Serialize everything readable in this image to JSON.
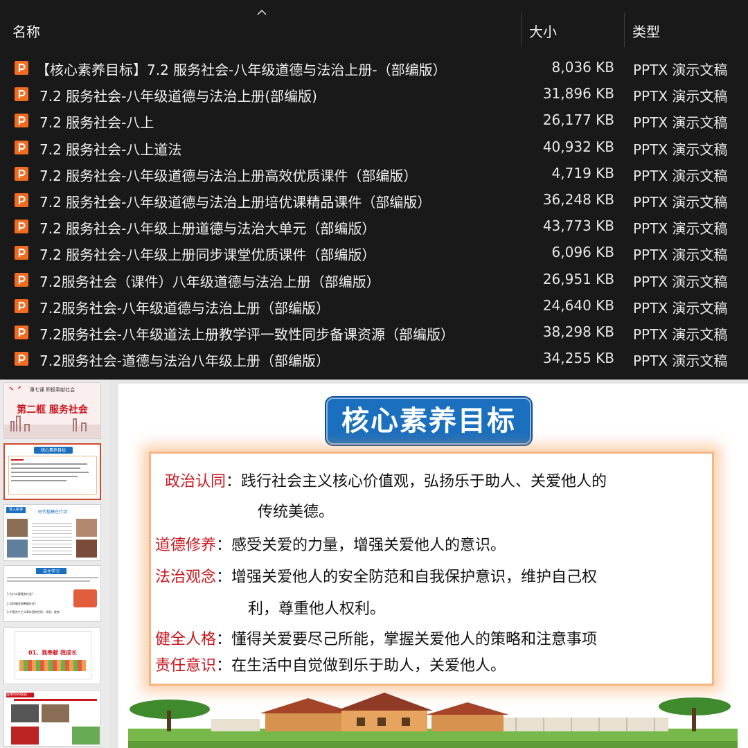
{
  "explorer": {
    "columns": {
      "name": "名称",
      "size": "大小",
      "type": "类型"
    },
    "files": [
      {
        "name": "【核心素养目标】7.2 服务社会-八年级道德与法治上册-（部编版）",
        "size": "8,036 KB",
        "type": "PPTX 演示文稿"
      },
      {
        "name": "7.2  服务社会-八年级道德与法治上册(部编版)",
        "size": "31,896 KB",
        "type": "PPTX 演示文稿"
      },
      {
        "name": "7.2  服务社会-八上",
        "size": "26,177 KB",
        "type": "PPTX 演示文稿"
      },
      {
        "name": "7.2  服务社会-八上道法",
        "size": "40,932 KB",
        "type": "PPTX 演示文稿"
      },
      {
        "name": "7.2 服务社会-八年级道德与法治上册高效优质课件（部编版）",
        "size": "4,719 KB",
        "type": "PPTX 演示文稿"
      },
      {
        "name": "7.2 服务社会-八年级道德与法治上册培优课精品课件（部编版）",
        "size": "36,248 KB",
        "type": "PPTX 演示文稿"
      },
      {
        "name": "7.2 服务社会-八年级上册道德与法治大单元（部编版）",
        "size": "43,773 KB",
        "type": "PPTX 演示文稿"
      },
      {
        "name": "7.2 服务社会-八年级上册同步课堂优质课件（部编版）",
        "size": "6,096 KB",
        "type": "PPTX 演示文稿"
      },
      {
        "name": "7.2服务社会（课件）八年级道德与法治上册（部编版）",
        "size": "26,951 KB",
        "type": "PPTX 演示文稿"
      },
      {
        "name": "7.2服务社会-八年级道德与法治上册（部编版）",
        "size": "24,640 KB",
        "type": "PPTX 演示文稿"
      },
      {
        "name": "7.2服务社会-八年级道法上册教学评一致性同步备课资源（部编版）",
        "size": "38,298 KB",
        "type": "PPTX 演示文稿"
      },
      {
        "name": "7.2服务社会-道德与法治八年级上册（部编版）",
        "size": "34,255 KB",
        "type": "PPTX 演示文稿"
      }
    ]
  },
  "ppt": {
    "thumbnails": {
      "t1_top": "第七课 积极奉献社会",
      "t1_title": "第二框 服务社会",
      "t2_title": "核心素养目标",
      "t3_left": "导入新课",
      "t3_title": "时代楷模在行动",
      "t4_title": "自主学习",
      "t4_q1": "1.为什么要服务社会？",
      "t4_q2": "2.怎样服务和奉献社会？",
      "t4_q3": "3.中国共产主义青年团的性质、作用、使命",
      "t5_title": "01、我奉献 我成长",
      "t6_title": "运用你的经验："
    },
    "slide": {
      "title": "核心素养目标",
      "goals": [
        {
          "key": "政治认同",
          "sep": "：",
          "text": "践行社会主义核心价值观，弘扬乐于助人、关爱他人的",
          "cont": "传统美德。"
        },
        {
          "key": "道德修养",
          "sep": "：",
          "text": "感受关爱的力量，增强关爱他人的意识。"
        },
        {
          "key": "法治观念",
          "sep": "：",
          "text": "增强关爱他人的安全防范和自我保护意识，维护自己权",
          "cont": "利，尊重他人权利。"
        },
        {
          "key": "健全人格",
          "sep": "：",
          "text": "懂得关爱要尽己所能，掌握关爱他人的策略和注意事项"
        },
        {
          "key": "责任意识",
          "sep": "：",
          "text": "在生活中自觉做到乐于助人，关爱他人。"
        }
      ]
    }
  },
  "colors": {
    "explorer_bg": "#191919",
    "ppt_icon": "#f26b21",
    "title_blue": "#1a6fbf",
    "goal_key_red": "#c8161d"
  }
}
